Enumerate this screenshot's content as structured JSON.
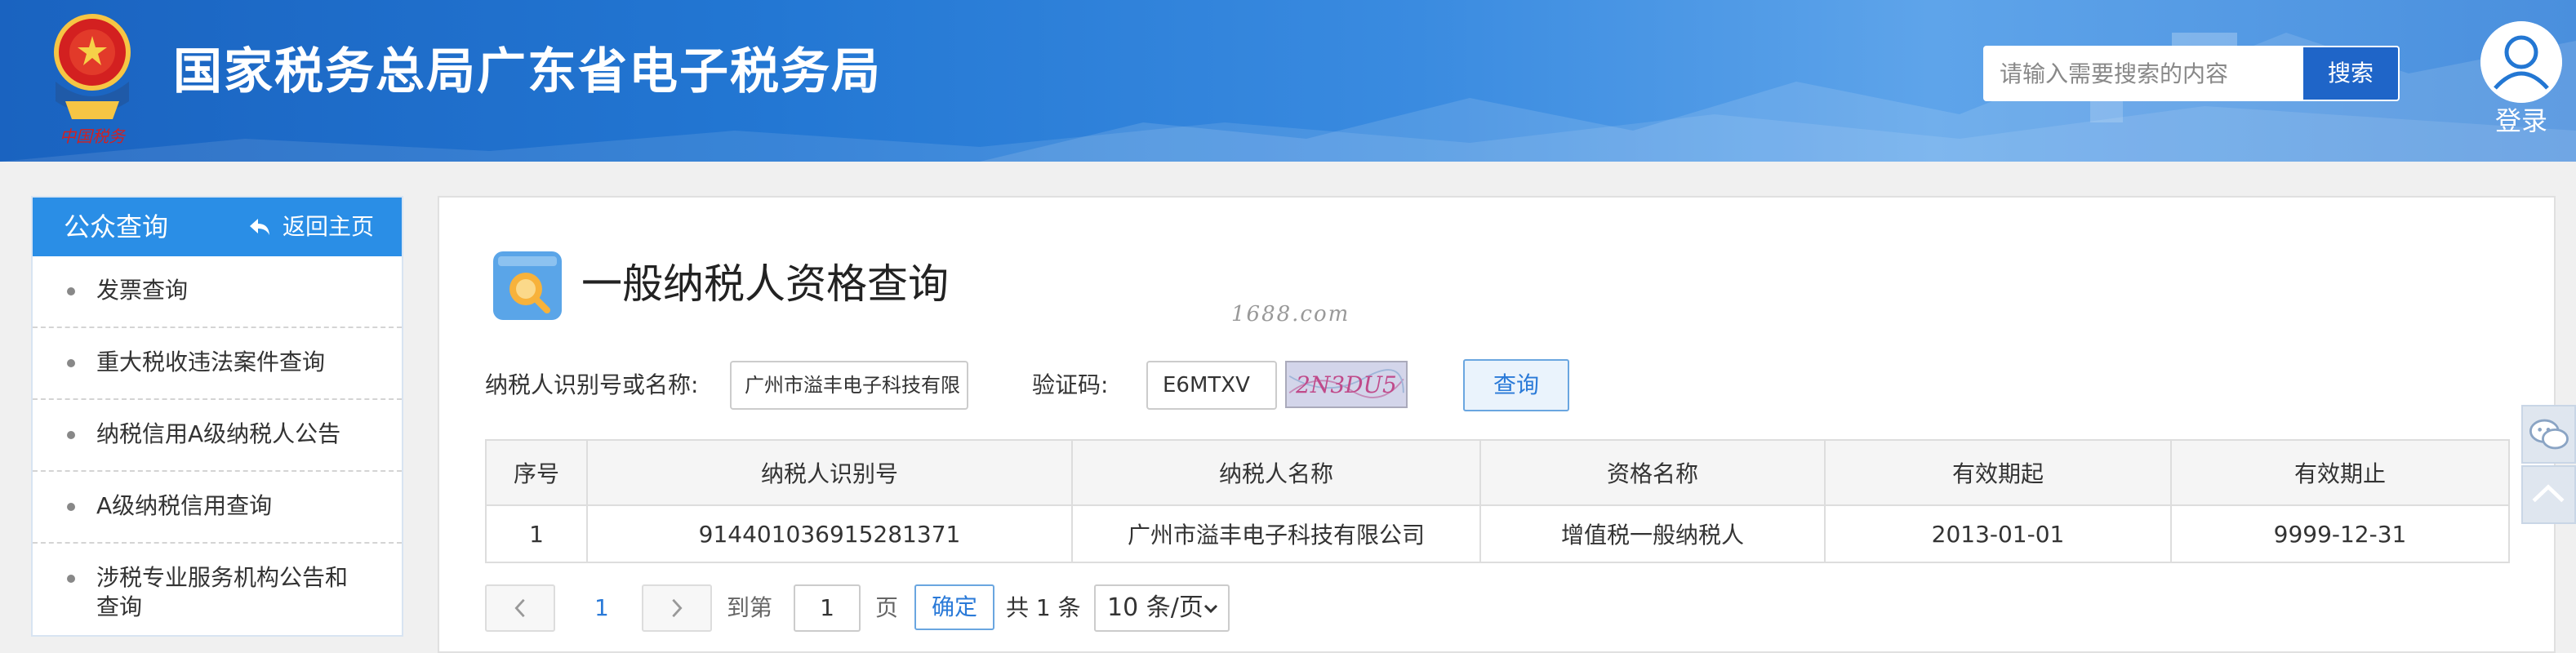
{
  "header": {
    "site_title": "国家税务总局广东省电子税务局",
    "search_placeholder": "请输入需要搜索的内容",
    "search_button": "搜索",
    "login_label": "登录",
    "emblem_caption": "中国税务"
  },
  "sidebar": {
    "title": "公众查询",
    "back_label": "返回主页",
    "items": [
      {
        "label": "发票查询"
      },
      {
        "label": "重大税收违法案件查询"
      },
      {
        "label": "纳税信用A级纳税人公告"
      },
      {
        "label": "A级纳税信用查询"
      },
      {
        "label": "涉税专业服务机构公告和查询"
      }
    ]
  },
  "main": {
    "page_title": "一般纳税人资格查询",
    "watermark": "1688.com",
    "taxpayer_label": "纳税人识别号或名称:",
    "taxpayer_value": "广州市溢丰电子科技有限",
    "captcha_label": "验证码:",
    "captcha_value": "E6MTXV",
    "captcha_image_text": "2N3DU5",
    "query_button": "查询",
    "table": {
      "headers": [
        "序号",
        "纳税人识别号",
        "纳税人名称",
        "资格名称",
        "有效期起",
        "有效期止"
      ],
      "rows": [
        [
          "1",
          "914401036915281371",
          "广州市溢丰电子科技有限公司",
          "增值税一般纳税人",
          "2013-01-01",
          "9999-12-31"
        ]
      ]
    },
    "pager": {
      "current_page": "1",
      "goto_label": "到第",
      "goto_value": "1",
      "page_unit": "页",
      "confirm_button": "确定",
      "total_text": "共 1 条",
      "page_size": "10 条/页"
    }
  },
  "colors": {
    "header_blue": "#2377d3",
    "sidebar_head": "#2a8ee6",
    "link_blue": "#2a7ad8"
  }
}
